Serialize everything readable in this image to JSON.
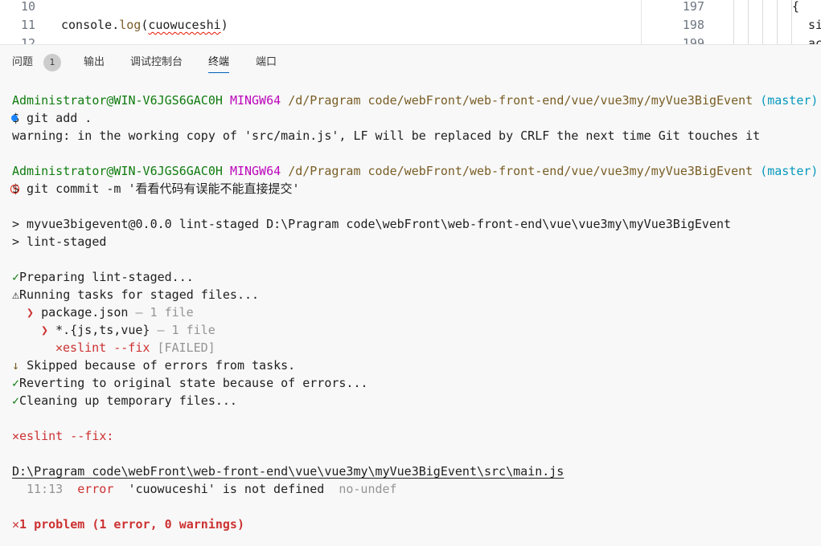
{
  "editor": {
    "left_lines": [
      {
        "num": "10",
        "code": ""
      },
      {
        "num": "11",
        "code_prefix": "console.",
        "code_fn": "log",
        "code_open": "(",
        "code_err": "cuowuceshi",
        "code_close": ")"
      },
      {
        "num": "12",
        "code": ""
      }
    ],
    "right_lines": [
      {
        "num": "197",
        "code": "{"
      },
      {
        "num": "198",
        "code": "si"
      },
      {
        "num": "199",
        "code": "ac"
      }
    ]
  },
  "panel_tabs": {
    "problems": "问题",
    "problems_count": "1",
    "output": "输出",
    "debug_console": "调试控制台",
    "terminal": "终端",
    "ports": "端口"
  },
  "terminal": {
    "prompt1": {
      "user": "Administrator@WIN-V6JGS6GAC0H",
      "shell": "MINGW64",
      "path": "/d/Pragram code/webFront/web-front-end/vue/vue3my/myVue3BigEvent",
      "branch": "(master)"
    },
    "cmd1": "$ git add .",
    "warning": "warning: in the working copy of 'src/main.js', LF will be replaced by CRLF the next time Git touches it",
    "prompt2": {
      "user": "Administrator@WIN-V6JGS6GAC0H",
      "shell": "MINGW64",
      "path": "/d/Pragram code/webFront/web-front-end/vue/vue3my/myVue3BigEvent",
      "branch": "(master)"
    },
    "cmd2": "$ git commit -m '看看代码有误能不能直接提交'",
    "npm1": "> myvue3bigevent@0.0.0 lint-staged D:\\Pragram code\\webFront\\web-front-end\\vue\\vue3my\\myVue3BigEvent",
    "npm2": "> lint-staged",
    "preparing": "Preparing lint-staged...",
    "running": "Running tasks for staged files...",
    "pkg": "package.json",
    "pkg_count": "— 1 file",
    "glob": "*.{js,ts,vue}",
    "glob_count": "— 1 file",
    "eslint_task": "eslint --fix",
    "failed": "[FAILED]",
    "skipped": "Skipped because of errors from tasks.",
    "reverting": "Reverting to original state because of errors...",
    "cleaning": "Cleaning up temporary files...",
    "eslint_header": "eslint --fix:",
    "file_path": "D:\\Pragram code\\webFront\\web-front-end\\vue\\vue3my\\myVue3BigEvent\\src\\main.js",
    "err_pos": "11:13",
    "err_level": "error",
    "err_msg": "'cuowuceshi' is not defined",
    "err_rule": "no-undef",
    "summary": "1 problem (1 error, 0 warnings)"
  },
  "glyphs": {
    "check": "✓",
    "warn": "⚠",
    "arrow": "❯",
    "cross": "✕",
    "down": "↓",
    "x_mark": "×"
  },
  "colors": {
    "green": "#107c10",
    "magenta": "#bc05bc",
    "yellow": "#795e26",
    "cyan": "#0598bc",
    "red": "#cd3131",
    "accent": "#005fb8"
  }
}
